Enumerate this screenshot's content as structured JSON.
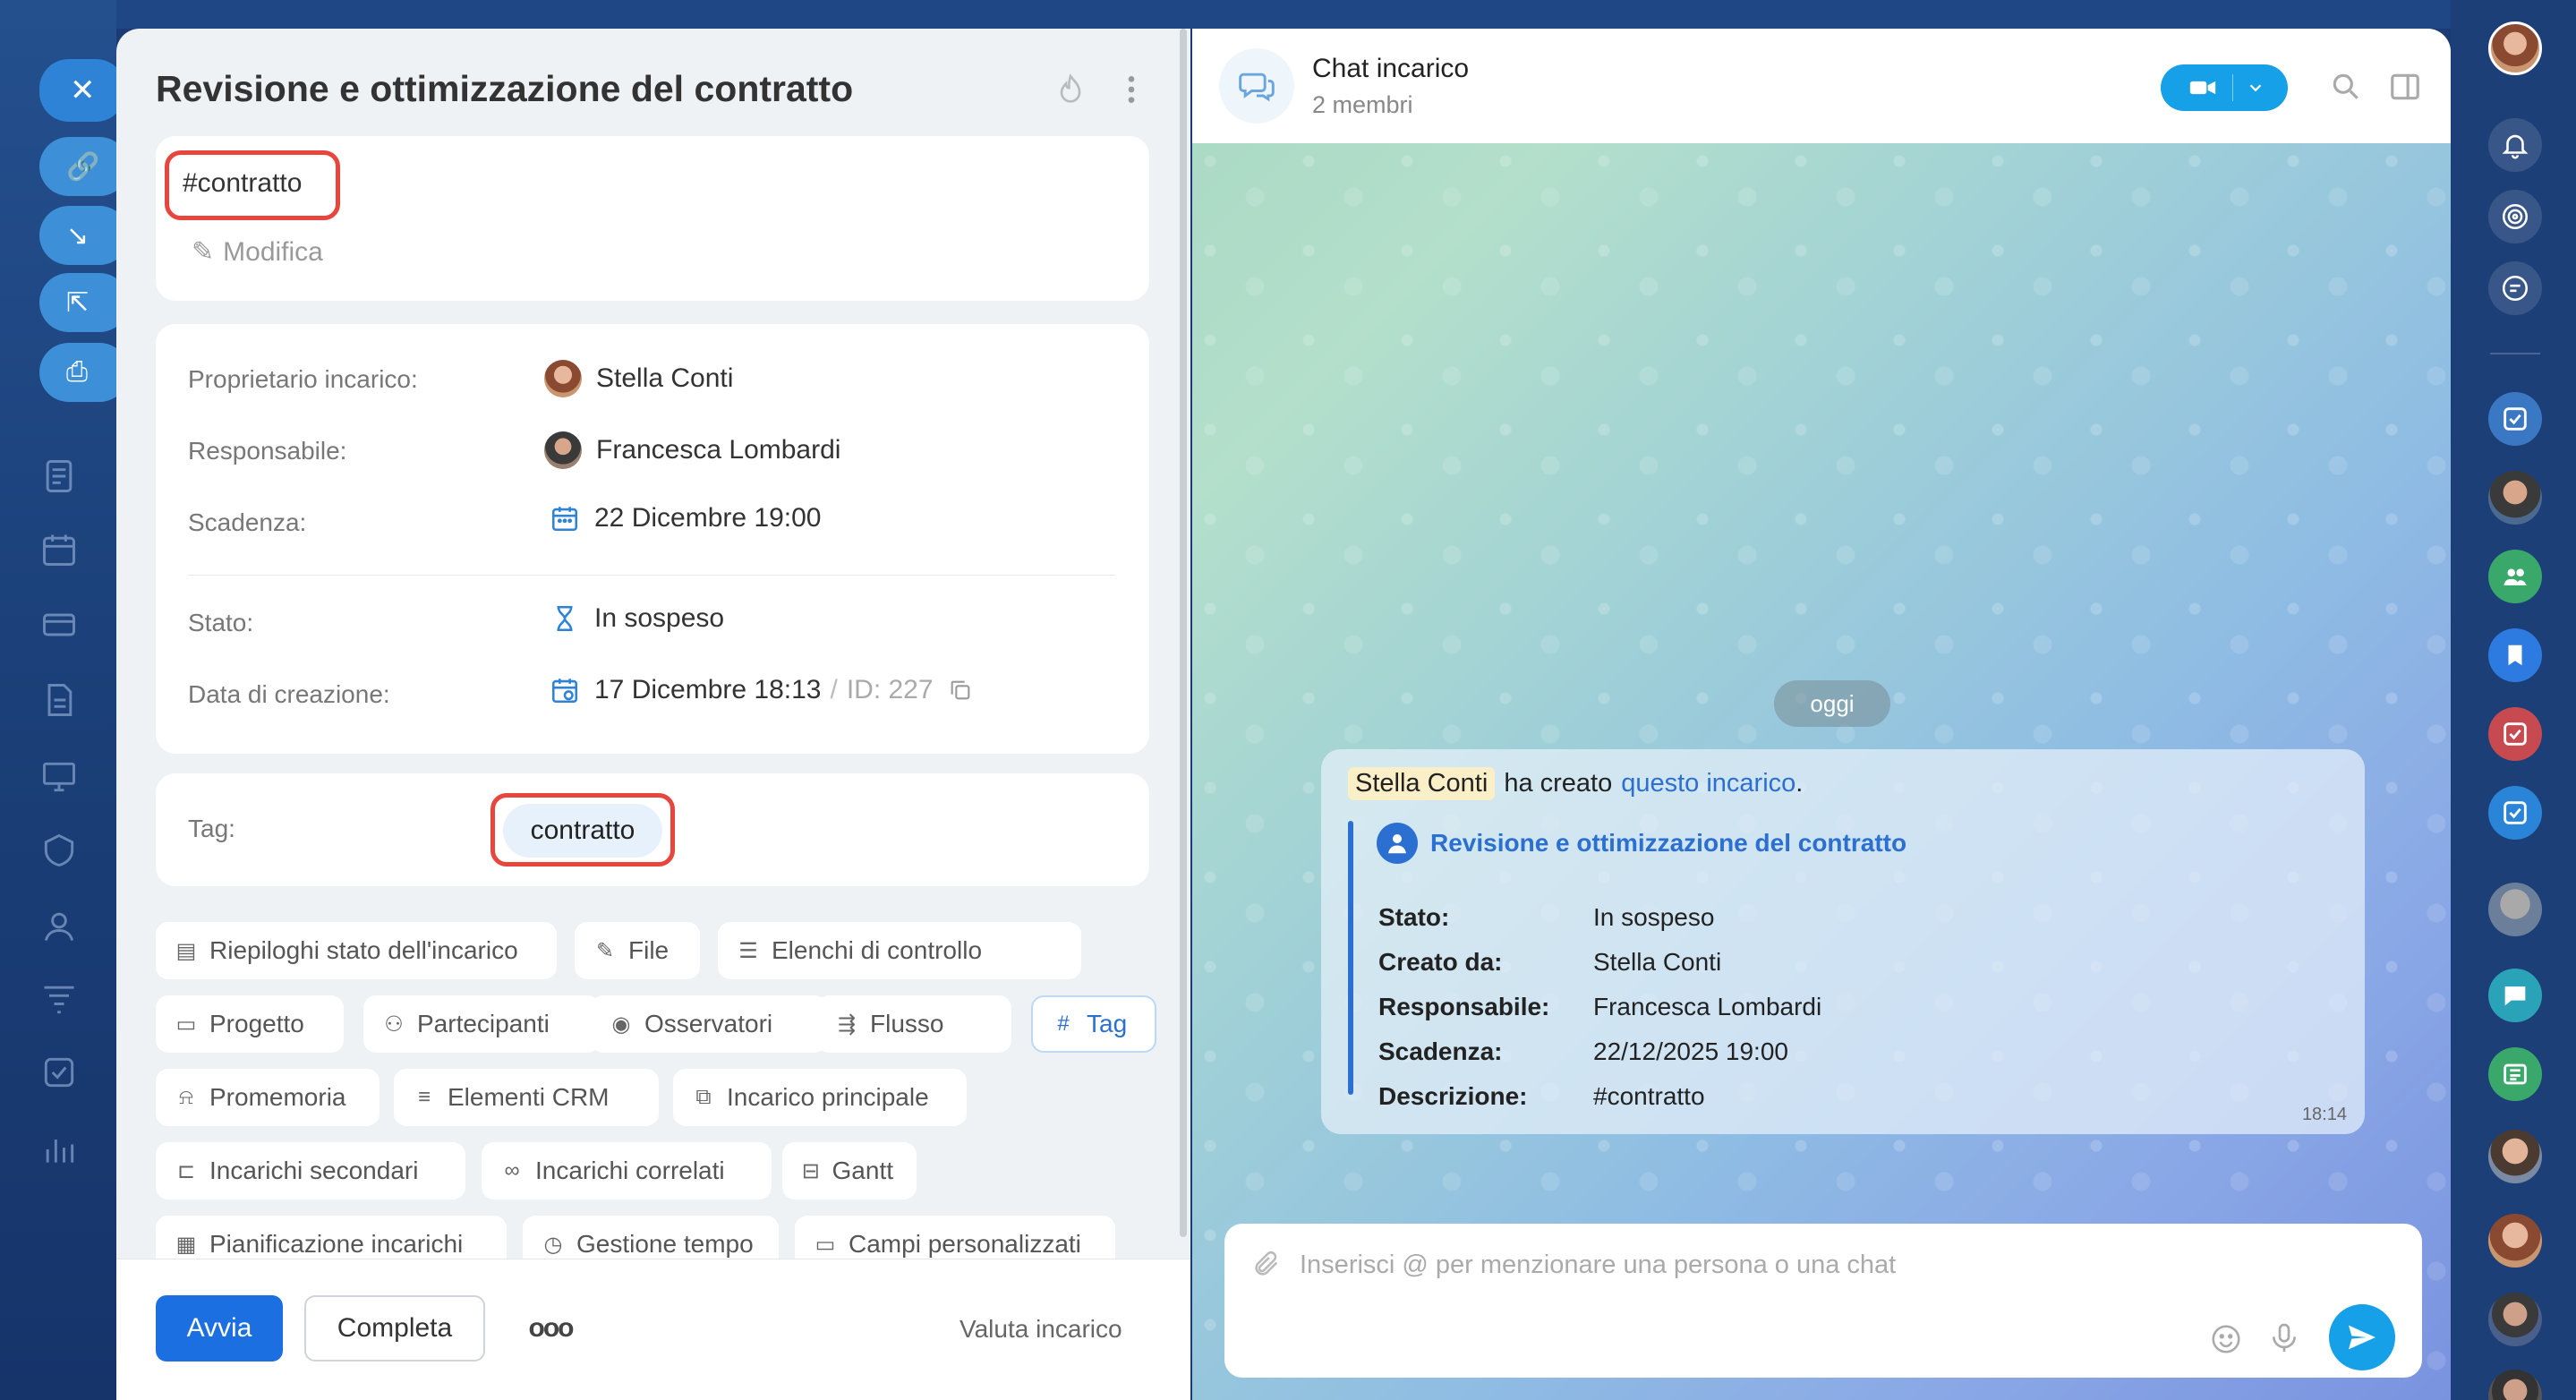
{
  "task": {
    "title": "Revisione e ottimizzazione del contratto",
    "description_tag": "#contratto",
    "edit_label": "Modifica"
  },
  "details": {
    "owner_label": "Proprietario incarico:",
    "owner_value": "Stella Conti",
    "responsible_label": "Responsabile:",
    "responsible_value": "Francesca Lombardi",
    "deadline_label": "Scadenza:",
    "deadline_value": "22 Dicembre 19:00",
    "status_label": "Stato:",
    "status_value": "In sospeso",
    "created_label": "Data di creazione:",
    "created_value": "17 Dicembre 18:13",
    "id_separator": "/",
    "id_value": "ID: 227"
  },
  "tags": {
    "label": "Tag:",
    "value": "contratto"
  },
  "chips": [
    {
      "label": "Riepiloghi stato dell'incarico",
      "icon": "summary-icon"
    },
    {
      "label": "File",
      "icon": "paperclip-icon"
    },
    {
      "label": "Elenchi di controllo",
      "icon": "checklist-icon"
    },
    {
      "label": "Progetto",
      "icon": "folder-icon"
    },
    {
      "label": "Partecipanti",
      "icon": "person-icon"
    },
    {
      "label": "Osservatori",
      "icon": "eye-icon"
    },
    {
      "label": "Flusso",
      "icon": "flow-icon"
    },
    {
      "label": "Tag",
      "icon": "hash-icon"
    },
    {
      "label": "Promemoria",
      "icon": "bell-icon"
    },
    {
      "label": "Elementi CRM",
      "icon": "crm-icon"
    },
    {
      "label": "Incarico principale",
      "icon": "parent-task-icon"
    },
    {
      "label": "Incarichi secondari",
      "icon": "subtask-icon"
    },
    {
      "label": "Incarichi correlati",
      "icon": "link-icon"
    },
    {
      "label": "Gantt",
      "icon": "gantt-icon"
    },
    {
      "label": "Pianificazione incarichi",
      "icon": "calendar-plan-icon"
    },
    {
      "label": "Gestione tempo",
      "icon": "timer-icon"
    },
    {
      "label": "Campi personalizzati",
      "icon": "fields-icon"
    }
  ],
  "footer": {
    "start_label": "Avvia",
    "complete_label": "Completa",
    "more_label": "ooo",
    "rate_label": "Valuta incarico"
  },
  "chat": {
    "title": "Chat incarico",
    "members": "2 membri",
    "date_pill": "oggi",
    "message": {
      "author": "Stella Conti",
      "text": "ha creato",
      "link": "questo incarico",
      "period": ".",
      "task_title": "Revisione e ottimizzazione del contratto",
      "fields": [
        {
          "label": "Stato:",
          "value": "In sospeso"
        },
        {
          "label": "Creato da:",
          "value": "Stella Conti"
        },
        {
          "label": "Responsabile:",
          "value": "Francesca Lombardi"
        },
        {
          "label": "Scadenza:",
          "value": "22/12/2025 19:00"
        },
        {
          "label": "Descrizione:",
          "value": "#contratto"
        }
      ],
      "time": "18:14"
    },
    "input_placeholder": "Inserisci @ per menzionare una persona o una chat"
  },
  "colors": {
    "accent": "#2f83d6",
    "primary_button": "#1b6fe0",
    "highlight": "#e8453d",
    "link": "#2b6fd1"
  }
}
